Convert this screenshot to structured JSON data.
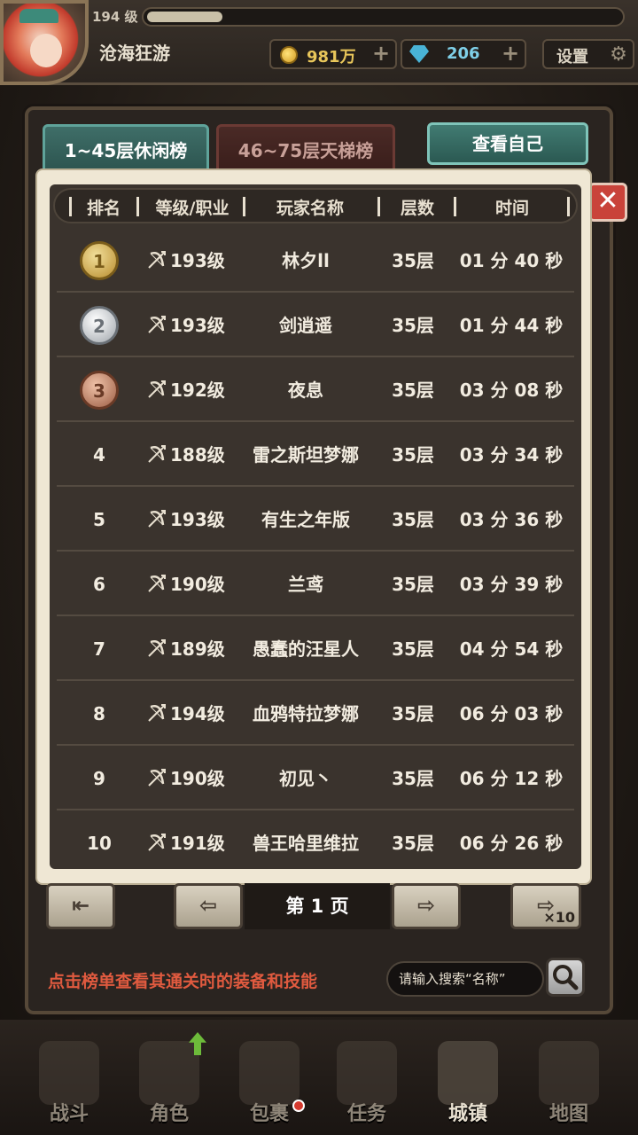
{
  "player": {
    "level": "194 级",
    "name": "沧海狂游",
    "xp_fraction": 0.16
  },
  "resources": {
    "gold": "981万",
    "gems": "206",
    "settings_label": "设置"
  },
  "tabs": [
    {
      "label": "1~45层休闲榜",
      "active": true
    },
    {
      "label": "46~75层天梯榜",
      "active": false
    }
  ],
  "view_self_label": "查看自己",
  "close_label": "✕",
  "table": {
    "headers": [
      "排名",
      "等级/职业",
      "玩家名称",
      "层数",
      "时间"
    ],
    "rows": [
      {
        "rank": "1",
        "level": "193级",
        "name": "林夕ll",
        "floor": "35层",
        "time": "01 分 40 秒"
      },
      {
        "rank": "2",
        "level": "193级",
        "name": "剑逍遥",
        "floor": "35层",
        "time": "01 分 44 秒"
      },
      {
        "rank": "3",
        "level": "192级",
        "name": "夜息",
        "floor": "35层",
        "time": "03 分 08 秒"
      },
      {
        "rank": "4",
        "level": "188级",
        "name": "雷之斯坦梦娜",
        "floor": "35层",
        "time": "03 分 34 秒"
      },
      {
        "rank": "5",
        "level": "193级",
        "name": "有生之年版",
        "floor": "35层",
        "time": "03 分 36 秒"
      },
      {
        "rank": "6",
        "level": "190级",
        "name": "兰鸢",
        "floor": "35层",
        "time": "03 分 39 秒"
      },
      {
        "rank": "7",
        "level": "189级",
        "name": "愚蠢的汪星人",
        "floor": "35层",
        "time": "04 分 54 秒"
      },
      {
        "rank": "8",
        "level": "194级",
        "name": "血鸦特拉梦娜",
        "floor": "35层",
        "time": "06 分 03 秒"
      },
      {
        "rank": "9",
        "level": "190级",
        "name": "初见丶",
        "floor": "35层",
        "time": "06 分 12 秒"
      },
      {
        "rank": "10",
        "level": "191级",
        "name": "兽王哈里维拉",
        "floor": "35层",
        "time": "06 分 26 秒"
      }
    ]
  },
  "pager": {
    "page_label": "第 1 页",
    "jump_label": "×10"
  },
  "hint": "点击榜单查看其通关时的装备和技能",
  "search": {
    "placeholder": "请输入搜索“名称”"
  },
  "nav": [
    {
      "label": "战斗",
      "icon": "sword-shield-icon"
    },
    {
      "label": "角色",
      "icon": "helmet-icon"
    },
    {
      "label": "包裹",
      "icon": "bag-icon"
    },
    {
      "label": "任务",
      "icon": "scroll-icon"
    },
    {
      "label": "城镇",
      "icon": "castle-icon"
    },
    {
      "label": "地图",
      "icon": "map-icon"
    }
  ]
}
